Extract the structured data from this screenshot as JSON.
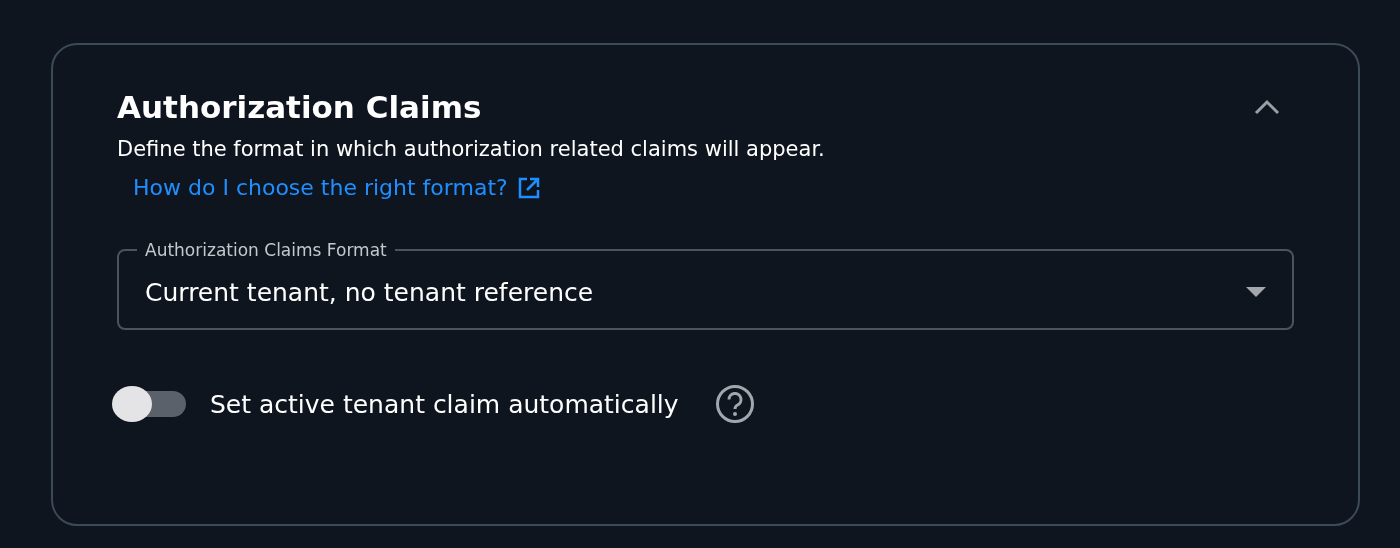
{
  "section": {
    "title": "Authorization Claims",
    "expanded": true,
    "description": "Define the format in which authorization related claims will appear.",
    "help_link": "How do I choose the right format?",
    "select": {
      "label": "Authorization Claims Format",
      "value": "Current tenant, no tenant reference"
    },
    "toggle": {
      "label": "Set active tenant claim automatically",
      "on": false
    }
  }
}
